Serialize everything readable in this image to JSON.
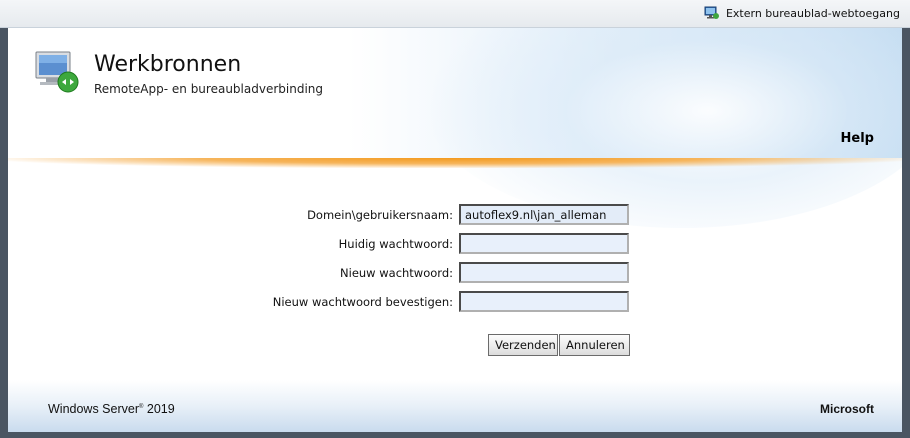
{
  "topbar": {
    "external_link": "Extern bureaublad-webtoegang",
    "icon": "remote-desktop-icon"
  },
  "header": {
    "title": "Werkbronnen",
    "subtitle": "RemoteApp- en bureaubladverbinding",
    "help_label": "Help",
    "logo_icon": "remote-desktop-monitor-icon"
  },
  "form": {
    "fields": [
      {
        "label": "Domein\\gebruikersnaam:",
        "value": "autoflex9.nl\\jan_alleman"
      },
      {
        "label": "Huidig wachtwoord:",
        "value": ""
      },
      {
        "label": "Nieuw wachtwoord:",
        "value": ""
      },
      {
        "label": "Nieuw wachtwoord bevestigen:",
        "value": ""
      }
    ],
    "submit_label": "Verzenden",
    "cancel_label": "Annuleren"
  },
  "footer": {
    "product_name": "Windows Server",
    "product_version": "2019",
    "vendor": "Microsoft"
  },
  "colors": {
    "accent_orange": "#f39a1e",
    "header_blue": "#c3dcf1",
    "field_background": "#e8f0fb"
  }
}
